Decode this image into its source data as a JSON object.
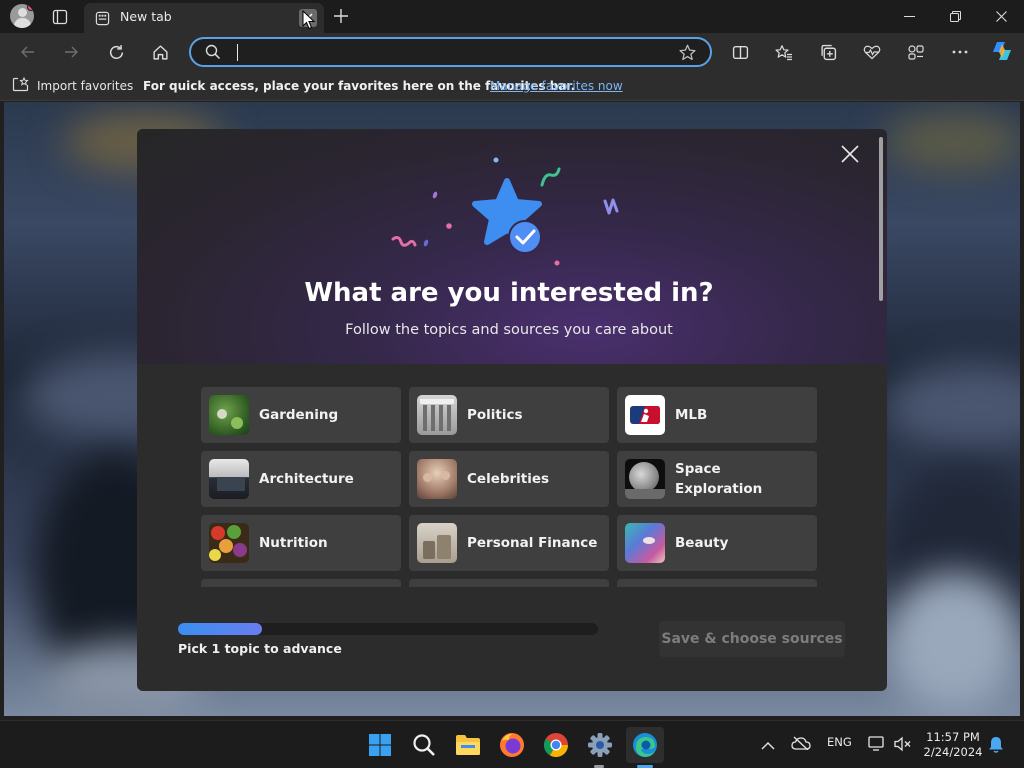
{
  "browser": {
    "tab_title": "New tab",
    "address_value": "",
    "favorites_bar": {
      "import_label": "Import favorites",
      "hint_text": "For quick access, place your favorites here on the favorites bar.",
      "manage_link": "Manage favorites now"
    }
  },
  "dialog": {
    "title": "What are you interested in?",
    "subtitle": "Follow the topics and sources you care about",
    "topics": [
      {
        "label": "Gardening",
        "icon": "gardening-thumb"
      },
      {
        "label": "Politics",
        "icon": "politics-thumb"
      },
      {
        "label": "MLB",
        "icon": "mlb-logo"
      },
      {
        "label": "Architecture",
        "icon": "architecture-thumb"
      },
      {
        "label": "Celebrities",
        "icon": "celebrities-thumb"
      },
      {
        "label": "Space Exploration",
        "icon": "space-thumb"
      },
      {
        "label": "Nutrition",
        "icon": "nutrition-thumb"
      },
      {
        "label": "Personal Finance",
        "icon": "finance-thumb"
      },
      {
        "label": "Beauty",
        "icon": "beauty-thumb"
      }
    ],
    "progress": {
      "fraction": 0.2,
      "text": "Pick 1 topic to advance"
    },
    "save_button": "Save & choose sources"
  },
  "taskbar": {
    "apps": [
      "start",
      "search",
      "file-explorer",
      "firefox",
      "chrome",
      "settings",
      "edge"
    ],
    "language": "ENG",
    "time": "11:57 PM",
    "date": "2/24/2024"
  },
  "colors": {
    "accent_blue": "#5aa2e6",
    "link_blue": "#7cb4f4",
    "dialog_bg": "#2c2c2c",
    "tile_bg": "#3f3f3f"
  }
}
